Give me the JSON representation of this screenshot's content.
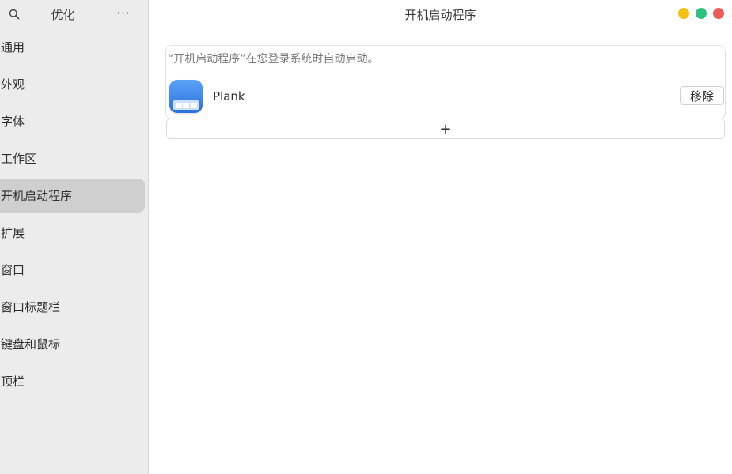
{
  "window": {
    "title": "开机启动程序",
    "controls": [
      {
        "name": "minimize",
        "color": "#f5c211"
      },
      {
        "name": "maximize",
        "color": "#2ec27e"
      },
      {
        "name": "close",
        "color": "#ed5b5b"
      }
    ]
  },
  "sidebar": {
    "title": "优化",
    "search_icon": "search-icon",
    "more_label": "···",
    "items": [
      {
        "label": "通用",
        "active": false
      },
      {
        "label": "外观",
        "active": false
      },
      {
        "label": "字体",
        "active": false
      },
      {
        "label": "工作区",
        "active": false
      },
      {
        "label": "开机启动程序",
        "active": true
      },
      {
        "label": "扩展",
        "active": false
      },
      {
        "label": "窗口",
        "active": false
      },
      {
        "label": "窗口标题栏",
        "active": false
      },
      {
        "label": "键盘和鼠标",
        "active": false
      },
      {
        "label": "顶栏",
        "active": false
      }
    ]
  },
  "main": {
    "description": "“开机启动程序”在您登录系统时自动启动。",
    "apps": [
      {
        "name": "Plank",
        "icon": "plank-icon",
        "remove_label": "移除"
      }
    ],
    "add_label": "+"
  }
}
